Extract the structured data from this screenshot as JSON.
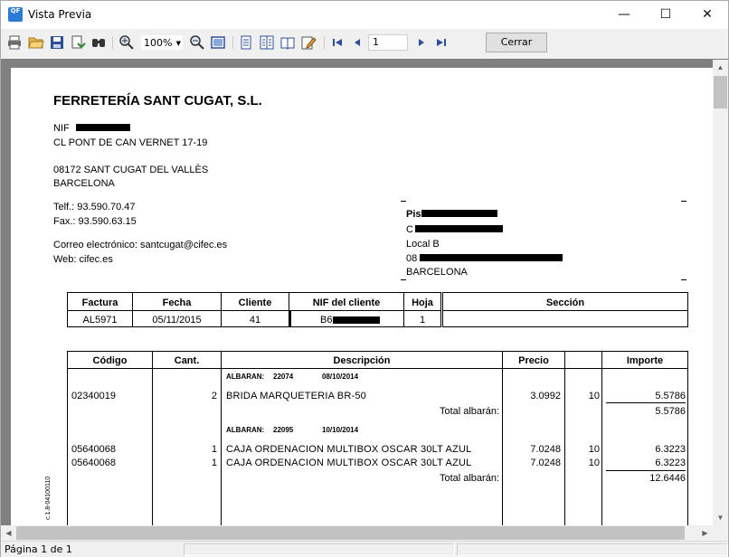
{
  "window": {
    "title": "Vista Previa",
    "icon_label": "QF",
    "minimize": "—",
    "maximize": "☐",
    "close": "✕"
  },
  "toolbar": {
    "zoom": "100%",
    "page_number": "1",
    "close_label": "Cerrar",
    "icons": [
      "print-icon",
      "open-icon",
      "save-icon",
      "export-icon",
      "find-icon",
      "zoom-in-icon",
      "zoom-out-icon",
      "fit-page-icon",
      "single-page-icon",
      "multi-page-icon",
      "book-icon",
      "edit-icon",
      "first-page-icon",
      "prev-page-icon",
      "next-page-icon",
      "last-page-icon"
    ]
  },
  "document": {
    "company": "FERRETERÍA SANT CUGAT, S.L.",
    "nif_label": "NIF",
    "address1": "CL PONT DE CAN VERNET 17-19",
    "postal_city": "08172 SANT CUGAT DEL VALLÈS",
    "city": "BARCELONA",
    "phone": "Telf.: 93.590.70.47",
    "fax": "Fax.: 93.590.63.15",
    "email": "Correo electrónico: santcugat@cifec.es",
    "web": "Web: cifec.es",
    "recipient": {
      "line1": "Pis",
      "line2": "C",
      "line3": "Local B",
      "line4": "08",
      "line5": "BARCELONA"
    },
    "info_table": {
      "headers": [
        "Factura",
        "Fecha",
        "Cliente",
        "NIF del cliente",
        "Hoja",
        "Sección"
      ],
      "values": [
        "AL5971",
        "05/11/2015",
        "41",
        "B6",
        "1",
        ""
      ]
    },
    "items_table": {
      "headers": [
        "Código",
        "Cant.",
        "Descripción",
        "Precio",
        "",
        "Importe"
      ],
      "groups": [
        {
          "albaran_label": "ALBARAN:",
          "albaran_no": "22074",
          "albaran_date": "08/10/2014",
          "rows": [
            {
              "code": "02340019",
              "qty": "2",
              "desc": "BRIDA MARQUETERIA BR-50",
              "price": "3.0992",
              "disc": "10",
              "amount": "5.5786"
            }
          ],
          "total_label": "Total albarán:",
          "total": "5.5786"
        },
        {
          "albaran_label": "ALBARAN:",
          "albaran_no": "22095",
          "albaran_date": "10/10/2014",
          "rows": [
            {
              "code": "05640068",
              "qty": "1",
              "desc": "CAJA ORDENACION MULTIBOX OSCAR 30LT AZUL",
              "price": "7.0248",
              "disc": "10",
              "amount": "6.3223"
            },
            {
              "code": "05640068",
              "qty": "1",
              "desc": "CAJA ORDENACION MULTIBOX OSCAR 30LT AZUL",
              "price": "7.0248",
              "disc": "10",
              "amount": "6.3223"
            }
          ],
          "total_label": "Total albarán:",
          "total": "12.6446"
        }
      ]
    },
    "side_code": "c.1.8-04100110"
  },
  "status": {
    "page_info": "Página 1 de 1"
  }
}
